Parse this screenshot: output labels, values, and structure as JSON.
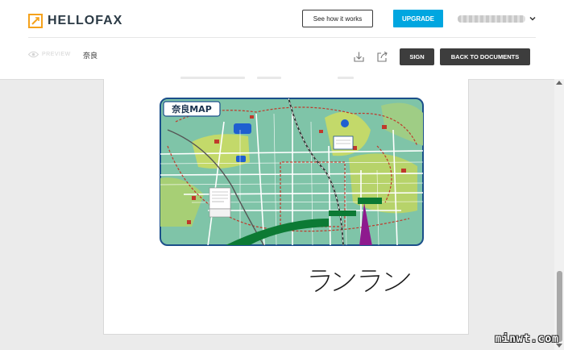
{
  "header": {
    "brand": "HELLOFAX",
    "how_it_works_label": "See how it works",
    "upgrade_label": "UPGRADE",
    "account_email": "(blurred email)"
  },
  "toolbar": {
    "preview_label": "PREVIEW",
    "document_name": "奈良",
    "sign_label": "SIGN",
    "back_label": "BACK TO DOCUMENTS"
  },
  "document": {
    "map_title": "奈良MAP",
    "map_colors": {
      "border": "#1b4f8a",
      "land": "#7fc4a8",
      "park": "#c3d96a",
      "water": "#1f5fd0",
      "road_major": "#ffffff",
      "rail": "#c0392b",
      "highlight": "#8e1a8e"
    },
    "signature_text": "ランラン"
  },
  "scrollbar": {
    "thumb_position": 0.76
  },
  "watermark": "minwt.com"
}
